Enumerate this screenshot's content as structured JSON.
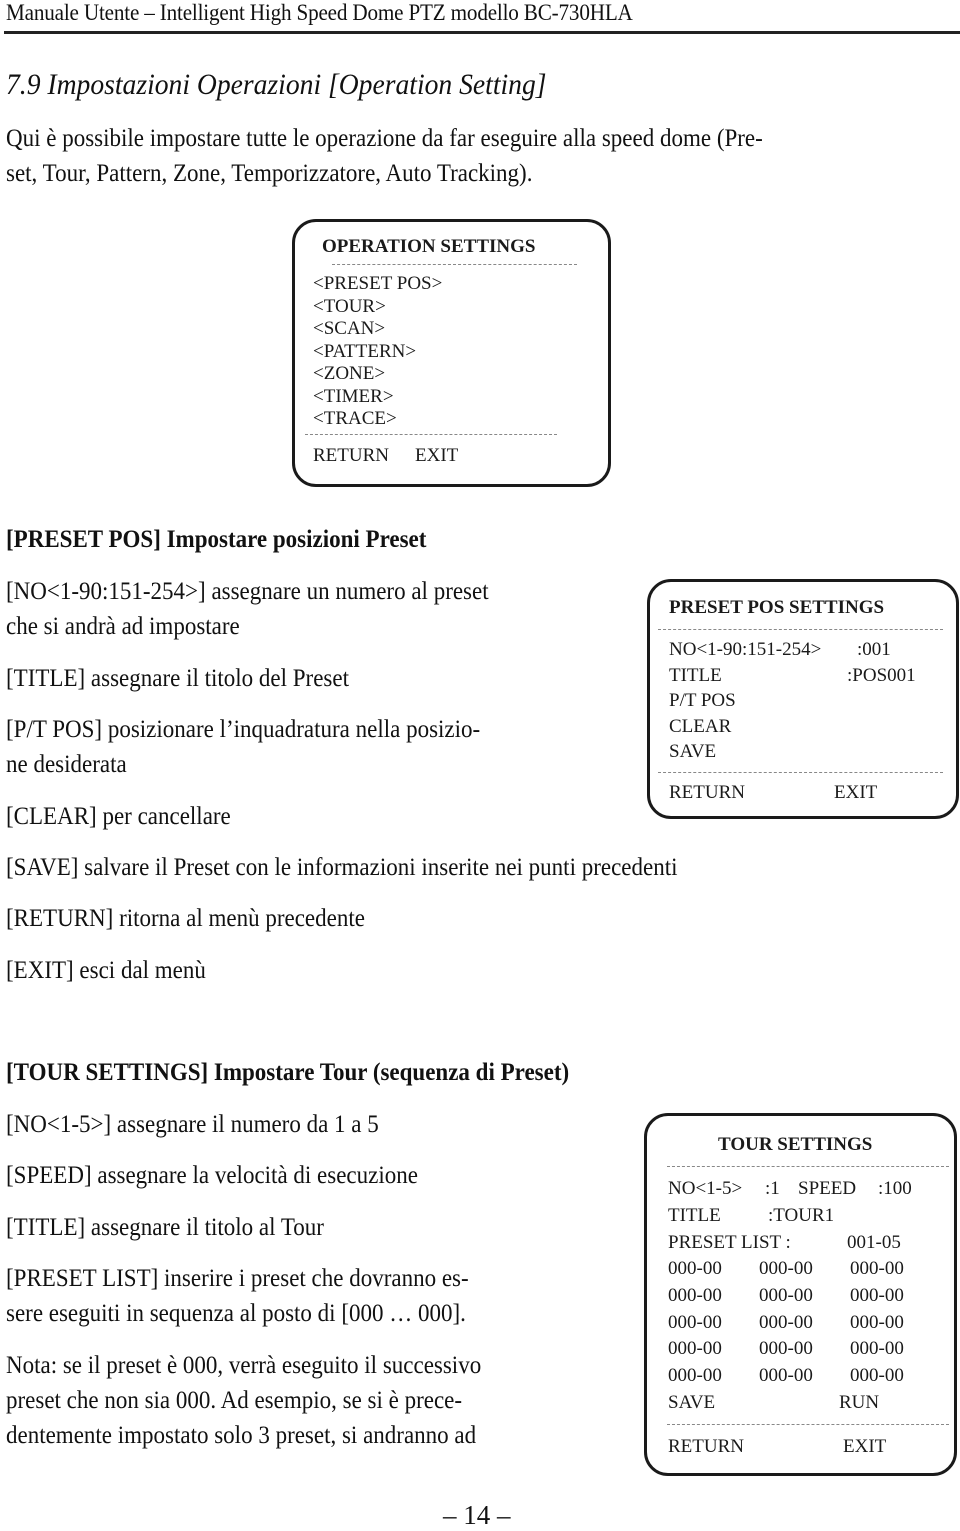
{
  "header": {
    "running_title": "Manuale Utente – Intelligent High Speed Dome PTZ modello BC-730HLA"
  },
  "section": {
    "title": "7.9  Impostazioni Operazioni [Operation Setting]",
    "intro_line1": "Qui è possibile impostare tutte le operazione da far eseguire alla speed dome (Pre-",
    "intro_line2": "set, Tour, Pattern, Zone, Temporizzatore, Auto Tracking)."
  },
  "operation_menu": {
    "title": "OPERATION  SETTINGS",
    "items": [
      "<PRESET   POS>",
      "<TOUR>",
      "<SCAN>",
      "<PATTERN>",
      "<ZONE>",
      "<TIMER>",
      "<TRACE>"
    ],
    "return_label": "RETURN",
    "exit_label": "EXIT"
  },
  "preset": {
    "heading": "[PRESET POS] Impostare posizioni Preset",
    "lines": [
      "[NO<1-90:151-254>] assegnare un numero al preset",
      "che si andrà ad impostare",
      "[TITLE] assegnare il titolo del Preset",
      "[P/T POS] posizionare l’inquadratura nella posizio-",
      "ne desiderata",
      "[CLEAR] per cancellare",
      "[SAVE] salvare il Preset con le informazioni inserite nei punti precedenti",
      "[RETURN] ritorna al menù precedente",
      "[EXIT] esci dal menù"
    ],
    "menu": {
      "title": "PRESET  POS  SETTINGS",
      "no_label": "NO<1-90:151-254>",
      "no_value": ":001",
      "title_label": "TITLE",
      "title_value": ":POS001",
      "pt_pos": "P/T  POS",
      "clear": "CLEAR",
      "save": "SAVE",
      "return_label": "RETURN",
      "exit_label": "EXIT"
    }
  },
  "tour": {
    "heading": "[TOUR SETTINGS] Impostare Tour (sequenza di Preset)",
    "lines": [
      "[NO<1-5>] assegnare il numero da 1 a 5",
      "[SPEED] assegnare la velocità di esecuzione",
      "[TITLE] assegnare il titolo al Tour",
      "[PRESET LIST] inserire i preset che dovranno es-",
      "sere eseguiti in sequenza al posto di [000 … 000].",
      "Nota: se il preset è 000, verrà eseguito il successivo",
      "preset che non sia 000. Ad esempio, se si è prece-",
      "dentemente impostato solo 3 preset, si andranno ad"
    ],
    "menu": {
      "title": "TOUR   SETTINGS",
      "no_label": "NO<1-5>",
      "no_value": ":1",
      "speed_label": "SPEED",
      "speed_value": ":100",
      "title_label": "TITLE",
      "title_value": ":TOUR1",
      "preset_list_label": "PRESET   LIST :",
      "preset_list_value": "001-05",
      "grid": [
        [
          "000-00",
          "000-00",
          "000-00"
        ],
        [
          "000-00",
          "000-00",
          "000-00"
        ],
        [
          "000-00",
          "000-00",
          "000-00"
        ],
        [
          "000-00",
          "000-00",
          "000-00"
        ],
        [
          "000-00",
          "000-00",
          "000-00"
        ]
      ],
      "save": "SAVE",
      "run": "RUN",
      "return_label": "RETURN",
      "exit_label": "EXIT"
    }
  },
  "footer": {
    "page_number": "– 14 –"
  }
}
